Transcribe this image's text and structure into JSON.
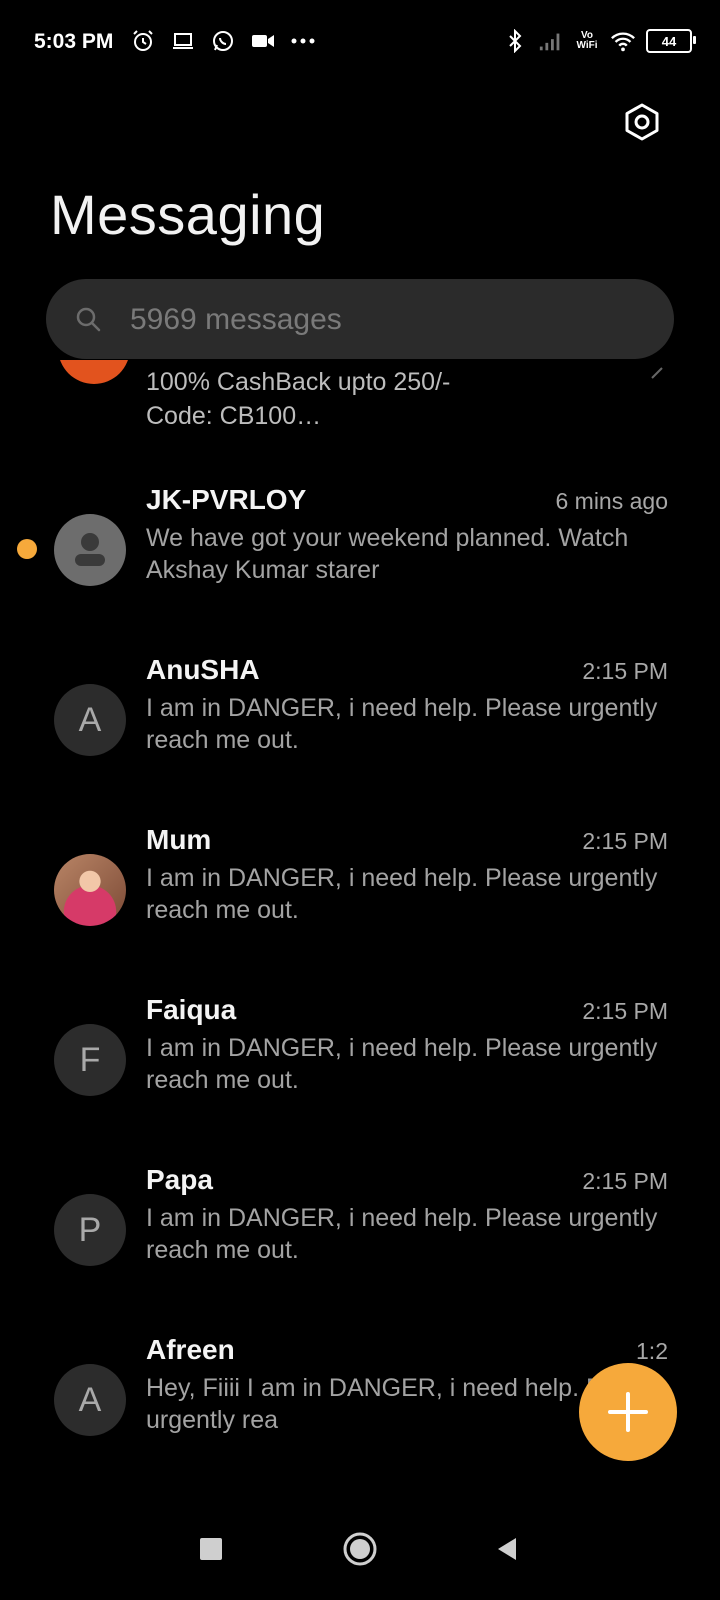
{
  "status_bar": {
    "time": "5:03 PM",
    "left_icons": [
      "alarm-icon",
      "laptop-icon",
      "whatsapp-icon",
      "video-icon",
      "more-dots-icon"
    ],
    "right_icons": [
      "bluetooth-icon",
      "signal-icon",
      "vowifi-icon",
      "wifi-icon",
      "battery-icon"
    ],
    "vowifi_top": "Vo",
    "vowifi_bottom": "WiFi",
    "battery": "44"
  },
  "header": {
    "title": "Messaging",
    "settings_icon": "settings-hexagon-icon"
  },
  "search": {
    "placeholder": "5969 messages"
  },
  "partial_item": {
    "line1": "100% CashBack upto 250/-",
    "line2": "Code: CB100…"
  },
  "conversations": [
    {
      "name": "JK-PVRLOY",
      "time": "6 mins ago",
      "preview": "We have got your weekend planned. Watch Akshay Kumar starer",
      "avatar_letter": "",
      "unread": true
    },
    {
      "name": "AnuSHA",
      "time": "2:15 PM",
      "preview": "I am in DANGER, i need help. Please urgently reach me out.",
      "avatar_letter": "A",
      "unread": false
    },
    {
      "name": "Mum",
      "time": "2:15 PM",
      "preview": "I am in DANGER, i need help. Please urgently reach me out.",
      "avatar_letter": "",
      "unread": false
    },
    {
      "name": "Faiqua",
      "time": "2:15 PM",
      "preview": "I am in DANGER, i need help. Please urgently reach me out.",
      "avatar_letter": "F",
      "unread": false
    },
    {
      "name": "Papa",
      "time": "2:15 PM",
      "preview": "I am in DANGER, i need help. Please urgently reach me out.",
      "avatar_letter": "P",
      "unread": false
    },
    {
      "name": "Afreen",
      "time": "1:2",
      "preview": "Hey, Fiiii I am in DANGER, i need help. Please urgently rea",
      "avatar_letter": "A",
      "unread": false
    }
  ],
  "fab": {
    "icon": "plus-icon",
    "color": "#f6a93b"
  },
  "nav": {
    "icons": [
      "recents-square-icon",
      "home-circle-icon",
      "back-triangle-icon"
    ]
  }
}
